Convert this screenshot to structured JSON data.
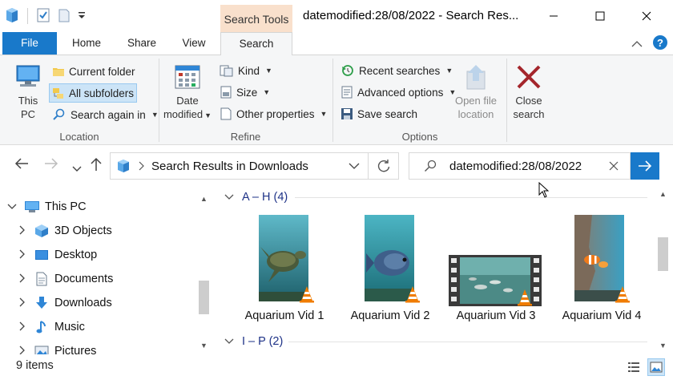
{
  "window": {
    "title": "datemodified:28/08/2022 - Search Res...",
    "context_tab_label": "Search Tools",
    "controls": [
      "minimize",
      "maximize",
      "close"
    ]
  },
  "ribbon_tabs": [
    {
      "label": "File",
      "state": "file"
    },
    {
      "label": "Home"
    },
    {
      "label": "Share"
    },
    {
      "label": "View"
    },
    {
      "label": "Search",
      "state": "selected"
    }
  ],
  "ribbon": {
    "location": {
      "label": "Location",
      "this_pc": {
        "line1": "This",
        "line2": "PC"
      },
      "current_folder": "Current folder",
      "all_subfolders": "All subfolders",
      "search_again": "Search again in"
    },
    "refine": {
      "label": "Refine",
      "date_modified": {
        "line1": "Date",
        "line2": "modified"
      },
      "kind": "Kind",
      "size": "Size",
      "other_properties": "Other properties"
    },
    "options": {
      "label": "Options",
      "recent_searches": "Recent searches",
      "advanced_options": "Advanced options",
      "save_search": "Save search",
      "open_file_location": {
        "line1": "Open file",
        "line2": "location"
      },
      "close_search": {
        "line1": "Close",
        "line2": "search"
      }
    }
  },
  "address_bar": {
    "path": "Search Results in Downloads"
  },
  "search": {
    "query": "datemodified:28/08/2022"
  },
  "nav_pane": {
    "items": [
      {
        "label": "This PC",
        "icon": "pc-icon",
        "expanded": true
      },
      {
        "label": "3D Objects",
        "icon": "cube-icon"
      },
      {
        "label": "Desktop",
        "icon": "desktop-icon"
      },
      {
        "label": "Documents",
        "icon": "document-icon"
      },
      {
        "label": "Downloads",
        "icon": "download-arrow-icon"
      },
      {
        "label": "Music",
        "icon": "music-note-icon"
      },
      {
        "label": "Pictures",
        "icon": "picture-icon"
      }
    ]
  },
  "content": {
    "groups": [
      {
        "label": "A – H (4)",
        "expanded": true
      },
      {
        "label": "I – P (2)",
        "expanded": true
      }
    ],
    "files": [
      {
        "name": "Aquarium Vid 1",
        "thumb": "turtle"
      },
      {
        "name": "Aquarium Vid 2",
        "thumb": "fish"
      },
      {
        "name": "Aquarium Vid 3",
        "thumb": "filmstrip"
      },
      {
        "name": "Aquarium Vid 4",
        "thumb": "clownfish"
      }
    ]
  },
  "status": {
    "item_count": "9 items"
  },
  "colors": {
    "accent": "#1979ca",
    "context_tab": "#f9e0cc",
    "ribbon_bg": "#f5f6f7",
    "selected_bg": "#cce4f7",
    "group_header": "#1e3287",
    "close_search_x": "#a4262c"
  }
}
